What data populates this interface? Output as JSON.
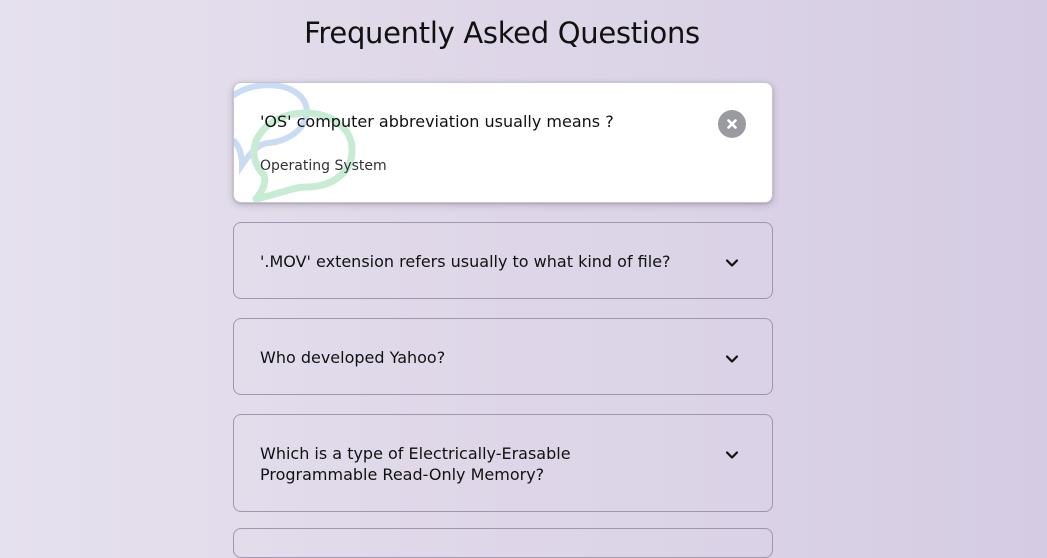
{
  "page": {
    "title": "Frequently Asked Questions"
  },
  "faqs": [
    {
      "question": "'OS' computer abbreviation usually means ?",
      "answer": "Operating System",
      "state": "expanded",
      "toggle_icon": "close-icon"
    },
    {
      "question": "'.MOV' extension refers usually to what kind of file?",
      "state": "collapsed",
      "toggle_icon": "chevron-down-icon"
    },
    {
      "question": "Who developed Yahoo?",
      "state": "collapsed",
      "toggle_icon": "chevron-down-icon"
    },
    {
      "question": "Which is a type of Electrically-Erasable Programmable Read-Only Memory?",
      "state": "collapsed",
      "toggle_icon": "chevron-down-icon"
    }
  ],
  "colors": {
    "background_start": "#e6e1ee",
    "background_end": "#d5cce3",
    "card_border": "#9f96b0",
    "active_card": "#ffffff",
    "close_button": "#9a9ba1",
    "chat_bubble_blue": "#c9dcf3",
    "chat_bubble_green": "#c7ecd3"
  }
}
